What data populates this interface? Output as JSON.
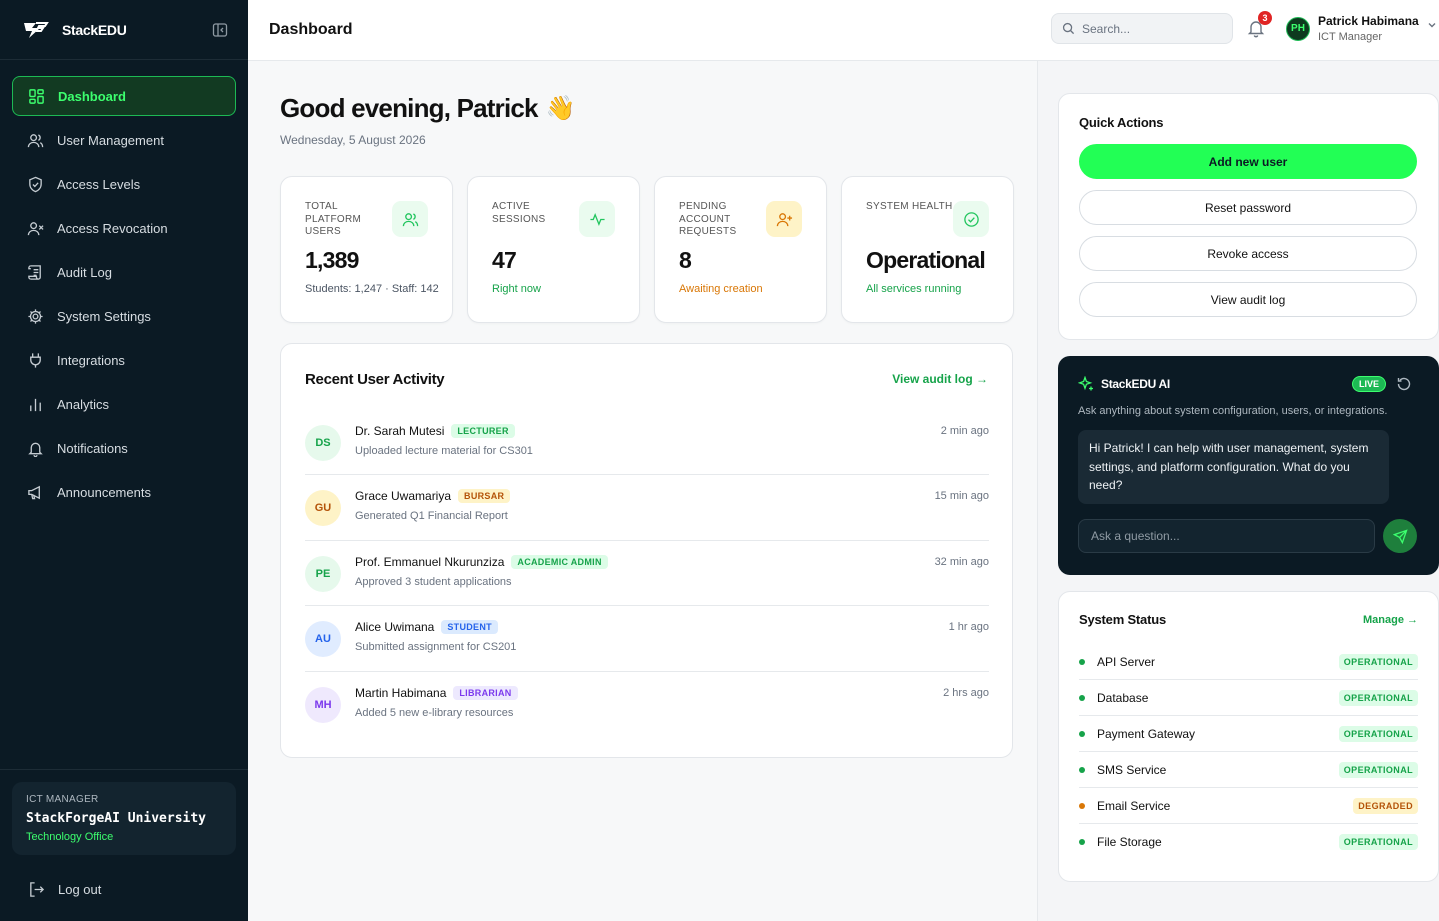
{
  "brand": {
    "name": "StackEDU"
  },
  "topbar": {
    "title": "Dashboard",
    "search_placeholder": "Search...",
    "notification_count": "3",
    "user": {
      "initials": "PH",
      "name": "Patrick Habimana",
      "role": "ICT Manager"
    }
  },
  "sidebar": {
    "items": [
      {
        "label": "Dashboard",
        "icon": "grid-icon"
      },
      {
        "label": "User Management",
        "icon": "users-icon"
      },
      {
        "label": "Access Levels",
        "icon": "shield-icon"
      },
      {
        "label": "Access Revocation",
        "icon": "user-x-icon"
      },
      {
        "label": "Audit Log",
        "icon": "scroll-icon"
      },
      {
        "label": "System Settings",
        "icon": "gear-icon"
      },
      {
        "label": "Integrations",
        "icon": "plug-icon"
      },
      {
        "label": "Analytics",
        "icon": "bar-chart-icon"
      },
      {
        "label": "Notifications",
        "icon": "bell-icon"
      },
      {
        "label": "Announcements",
        "icon": "megaphone-icon"
      }
    ],
    "org": {
      "role": "ICT MANAGER",
      "name": "StackForgeAI University",
      "dept": "Technology Office"
    },
    "logout_label": "Log out"
  },
  "main": {
    "greeting": "Good evening, Patrick",
    "greeting_emoji": "👋",
    "date": "Wednesday, 5 August 2026",
    "stats": [
      {
        "label": "TOTAL PLATFORM USERS",
        "value": "1,389",
        "sub": "Students: 1,247 · Staff: 142",
        "sub_color": "#4b5563",
        "icon": "users-icon",
        "icon_color": "#22c55e",
        "icon_bg": "#eafbef"
      },
      {
        "label": "ACTIVE SESSIONS",
        "value": "47",
        "sub": "Right now",
        "sub_color": "#16a34a",
        "icon": "activity-icon",
        "icon_color": "#22c55e",
        "icon_bg": "#eafbef"
      },
      {
        "label": "PENDING ACCOUNT REQUESTS",
        "value": "8",
        "sub": "Awaiting creation",
        "sub_color": "#d97706",
        "icon": "user-plus-icon",
        "icon_color": "#d97706",
        "icon_bg": "#fef3c7"
      },
      {
        "label": "SYSTEM HEALTH",
        "value": "Operational",
        "sub": "All services running",
        "sub_color": "#16a34a",
        "icon": "check-circle-icon",
        "icon_color": "#22c55e",
        "icon_bg": "#eafbef"
      }
    ],
    "activity": {
      "title": "Recent User Activity",
      "link": "View audit log →",
      "rows": [
        {
          "initials": "DS",
          "name": "Dr. Sarah Mutesi",
          "badge": "LECTURER",
          "desc": "Uploaded lecture material for CS301",
          "time": "2 min ago",
          "badge_color": "#16a34a",
          "badge_bg": "#dcfce7",
          "avatar_color": "#16a34a",
          "avatar_bg": "#e6f9ec"
        },
        {
          "initials": "GU",
          "name": "Grace Uwamariya",
          "badge": "BURSAR",
          "desc": "Generated Q1 Financial Report",
          "time": "15 min ago",
          "badge_color": "#b45309",
          "badge_bg": "#fef3c7",
          "avatar_color": "#b45309",
          "avatar_bg": "#fef3c7"
        },
        {
          "initials": "PE",
          "name": "Prof. Emmanuel Nkurunziza",
          "badge": "ACADEMIC ADMIN",
          "desc": "Approved 3 student applications",
          "time": "32 min ago",
          "badge_color": "#16a34a",
          "badge_bg": "#dcfce7",
          "avatar_color": "#16a34a",
          "avatar_bg": "#e6f9ec"
        },
        {
          "initials": "AU",
          "name": "Alice Uwimana",
          "badge": "STUDENT",
          "desc": "Submitted assignment for CS201",
          "time": "1 hr ago",
          "badge_color": "#2563eb",
          "badge_bg": "#dbeafe",
          "avatar_color": "#2563eb",
          "avatar_bg": "#e0ecff"
        },
        {
          "initials": "MH",
          "name": "Martin Habimana",
          "badge": "LIBRARIAN",
          "desc": "Added 5 new e-library resources",
          "time": "2 hrs ago",
          "badge_color": "#7c3aed",
          "badge_bg": "#ede9fe",
          "avatar_color": "#7c3aed",
          "avatar_bg": "#efe9fd"
        }
      ]
    }
  },
  "quick_actions": {
    "title": "Quick Actions",
    "buttons": [
      "Add new user",
      "Reset password",
      "Revoke access",
      "View audit log"
    ]
  },
  "ai": {
    "title": "StackEDU AI",
    "live": "LIVE",
    "subtitle": "Ask anything about system configuration, users, or integrations.",
    "message": "Hi Patrick! I can help with user management, system settings, and platform configuration. What do you need?",
    "placeholder": "Ask a question..."
  },
  "system_status": {
    "title": "System Status",
    "link": "Manage →",
    "services": [
      {
        "name": "API Server",
        "status": "OPERATIONAL",
        "color": "#16a34a",
        "bg": "#dcfce7"
      },
      {
        "name": "Database",
        "status": "OPERATIONAL",
        "color": "#16a34a",
        "bg": "#dcfce7"
      },
      {
        "name": "Payment Gateway",
        "status": "OPERATIONAL",
        "color": "#16a34a",
        "bg": "#dcfce7"
      },
      {
        "name": "SMS Service",
        "status": "OPERATIONAL",
        "color": "#16a34a",
        "bg": "#dcfce7"
      },
      {
        "name": "Email Service",
        "status": "DEGRADED",
        "color": "#b45309",
        "bg": "#fef3c7",
        "dot": "#d97706"
      },
      {
        "name": "File Storage",
        "status": "OPERATIONAL",
        "color": "#16a34a",
        "bg": "#dcfce7"
      }
    ]
  }
}
